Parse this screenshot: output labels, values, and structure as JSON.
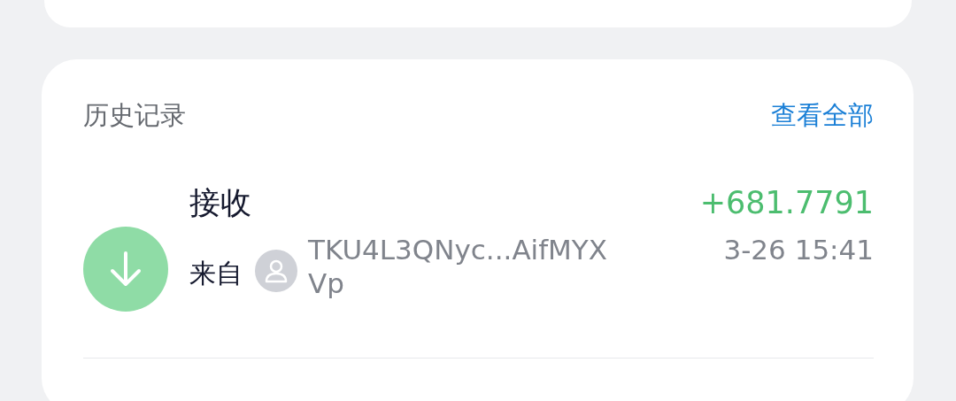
{
  "history": {
    "title": "历史记录",
    "view_all": "查看全部",
    "records": [
      {
        "kind": "receive",
        "type_label": "接收",
        "amount": "+681.7791",
        "from_label": "来自",
        "address": "TKU4L3QNyc...AifMYXVp",
        "time": "3-26 15:41"
      }
    ]
  }
}
